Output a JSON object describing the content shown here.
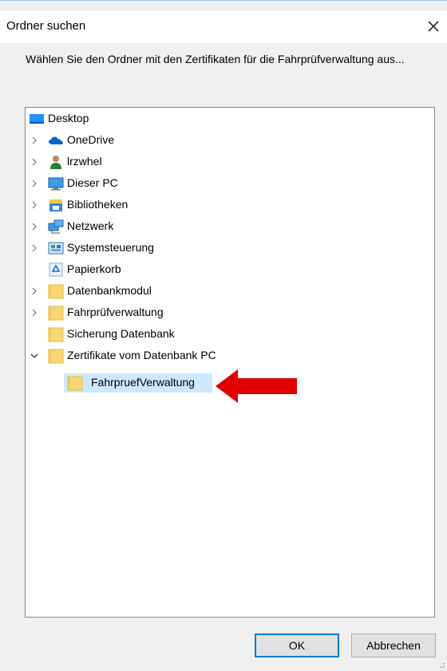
{
  "window": {
    "title": "Ordner suchen",
    "close_icon": "close-icon"
  },
  "prompt": "Wählen Sie den Ordner mit den Zertifikaten für die Fahrprüfverwaltung aus...",
  "tree": {
    "items": [
      {
        "label": "Desktop",
        "icon": "desktop-icon",
        "expander": "none",
        "level": 0
      },
      {
        "label": "OneDrive",
        "icon": "cloud-icon",
        "expander": "collapsed",
        "level": 1
      },
      {
        "label": "lrzwhel",
        "icon": "user-icon",
        "expander": "collapsed",
        "level": 1
      },
      {
        "label": "Dieser PC",
        "icon": "computer-icon",
        "expander": "collapsed",
        "level": 1
      },
      {
        "label": "Bibliotheken",
        "icon": "library-icon",
        "expander": "collapsed",
        "level": 1
      },
      {
        "label": "Netzwerk",
        "icon": "network-icon",
        "expander": "collapsed",
        "level": 1
      },
      {
        "label": "Systemsteuerung",
        "icon": "control-panel-icon",
        "expander": "collapsed",
        "level": 1
      },
      {
        "label": "Papierkorb",
        "icon": "recycle-bin-icon",
        "expander": "none",
        "level": 1
      },
      {
        "label": "Datenbankmodul",
        "icon": "folder-icon",
        "expander": "collapsed",
        "level": 1
      },
      {
        "label": "Fahrprüfverwaltung",
        "icon": "folder-icon",
        "expander": "collapsed",
        "level": 1
      },
      {
        "label": "Sicherung Datenbank",
        "icon": "folder-icon",
        "expander": "none",
        "level": 1
      },
      {
        "label": "Zertifikate vom Datenbank PC",
        "icon": "folder-icon",
        "expander": "expanded",
        "level": 1
      },
      {
        "label": "FahrpruefVerwaltung",
        "icon": "folder-icon",
        "expander": "none",
        "level": 2,
        "selected": true
      }
    ]
  },
  "annotation": {
    "arrow_color": "#e00000",
    "icon": "red-arrow-icon"
  },
  "buttons": {
    "ok_label": "OK",
    "cancel_label": "Abbrechen"
  },
  "colors": {
    "selection": "#cce8ff",
    "default_button_border": "#0078d7",
    "folder": "#f8d775"
  }
}
